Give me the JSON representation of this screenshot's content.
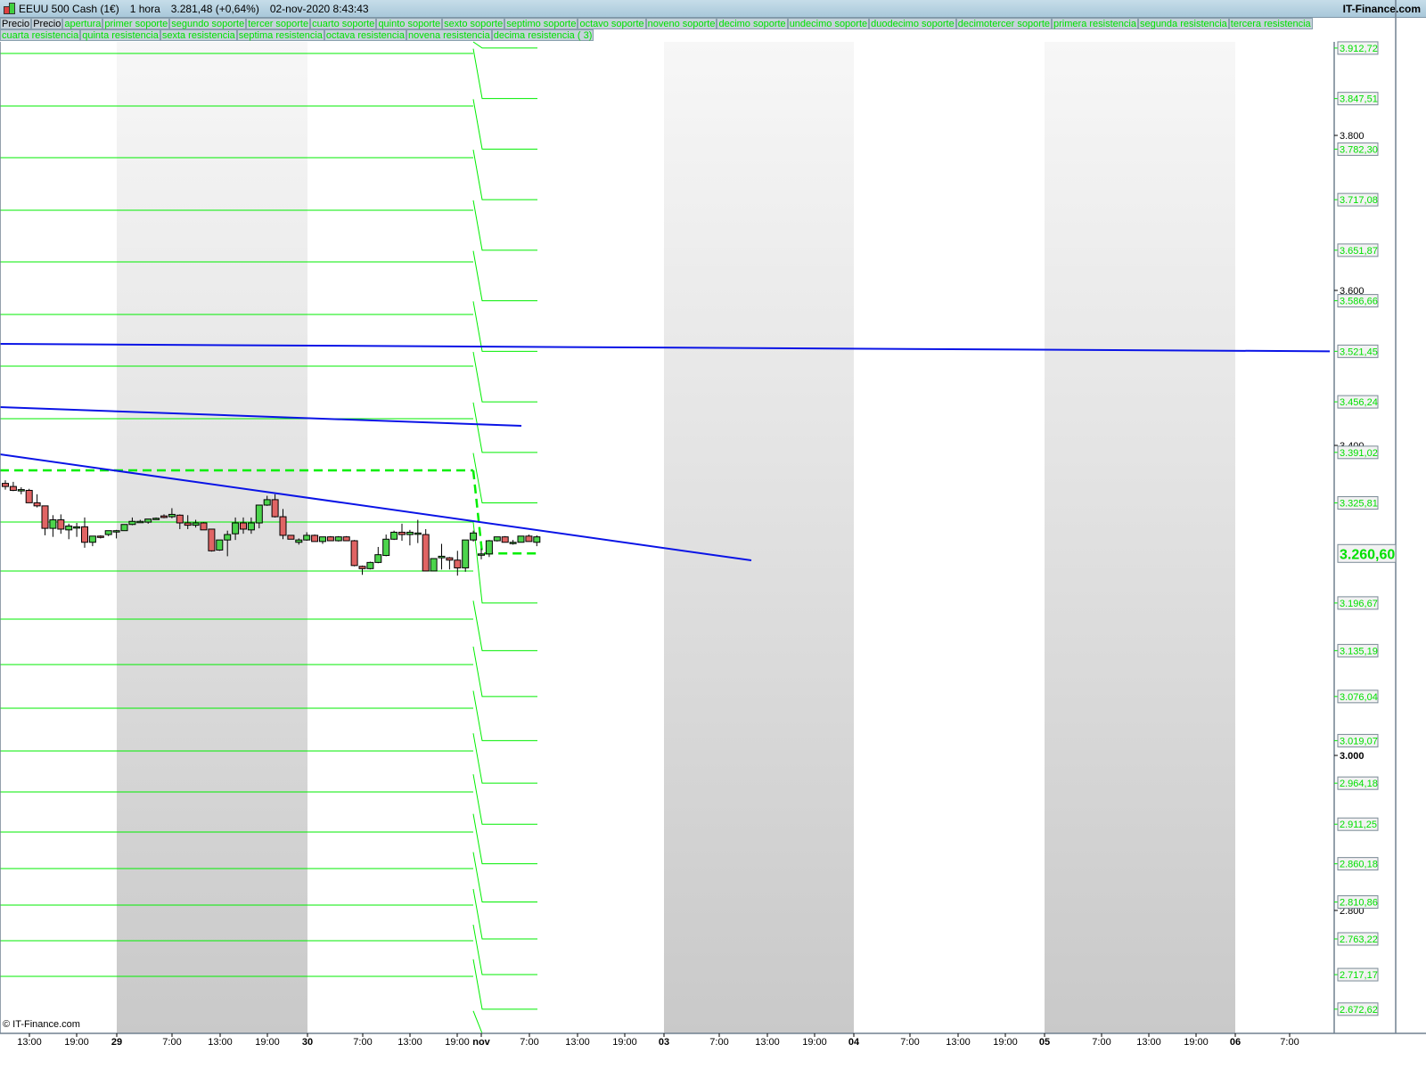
{
  "header": {
    "instrument": "EEUU 500 Cash (1€)",
    "timeframe": "1 hora",
    "price": "3.281,48 (+0,64%)",
    "datetime": "02-nov-2020 8:43:43",
    "brand": "IT-Finance.com"
  },
  "legend": {
    "row1": [
      "Precio",
      "Precio",
      "apertura",
      "primer soporte",
      "segundo soporte",
      "tercer soporte",
      "cuarto soporte",
      "quinto soporte",
      "sexto soporte",
      "septimo soporte",
      "octavo soporte",
      "noveno soporte",
      "decimo soporte",
      "undecimo soporte",
      "duodecimo soporte",
      "decimotercer soporte",
      "primera resistencia",
      "segunda resistencia",
      "tercera resistencia"
    ],
    "row2": [
      "cuarta resistencia",
      "quinta resistencia",
      "sexta resistencia",
      "septima resistencia",
      "octava resistencia",
      "novena resistencia",
      "decima resistencia ( 3)"
    ]
  },
  "copyright": "© IT-Finance.com",
  "colors": {
    "level": "#00ee00",
    "trend": "#0a14e6",
    "up": "#4cd44c",
    "down": "#e06464",
    "band": "#d4d4d4"
  },
  "chart_data": {
    "type": "candlestick",
    "price_axis_ticks": [
      {
        "value": 3800,
        "label": "3.800",
        "bold": false
      },
      {
        "value": 3600,
        "label": "3.600",
        "bold": false
      },
      {
        "value": 3400,
        "label": "3.400",
        "bold": false
      },
      {
        "value": 3000,
        "label": "3.000",
        "bold": true
      },
      {
        "value": 2800,
        "label": "2.800",
        "bold": false
      }
    ],
    "level_labels": [
      {
        "value": 3912.72,
        "label": "3.912,72"
      },
      {
        "value": 3847.51,
        "label": "3.847,51"
      },
      {
        "value": 3782.3,
        "label": "3.782,30"
      },
      {
        "value": 3717.08,
        "label": "3.717,08"
      },
      {
        "value": 3651.87,
        "label": "3.651,87"
      },
      {
        "value": 3586.66,
        "label": "3.586,66"
      },
      {
        "value": 3521.45,
        "label": "3.521,45"
      },
      {
        "value": 3456.24,
        "label": "3.456,24"
      },
      {
        "value": 3391.02,
        "label": "3.391,02"
      },
      {
        "value": 3325.81,
        "label": "3.325,81"
      },
      {
        "value": 3196.67,
        "label": "3.196,67"
      },
      {
        "value": 3135.19,
        "label": "3.135,19"
      },
      {
        "value": 3076.04,
        "label": "3.076,04"
      },
      {
        "value": 3019.07,
        "label": "3.019,07"
      },
      {
        "value": 2964.18,
        "label": "2.964,18"
      },
      {
        "value": 2911.25,
        "label": "2.911,25"
      },
      {
        "value": 2860.18,
        "label": "2.860,18"
      },
      {
        "value": 2810.86,
        "label": "2.810,86"
      },
      {
        "value": 2763.22,
        "label": "2.763,22"
      },
      {
        "value": 2717.17,
        "label": "2.717,17"
      },
      {
        "value": 2672.62,
        "label": "2.672,62"
      }
    ],
    "current_open": {
      "value": 3260.6,
      "label": "3.260,60"
    },
    "previous_levels": [
      3905.7,
      3837.9,
      3771.3,
      3703.4,
      3636.8,
      3569.0,
      3502.3,
      3434.5,
      3301.1,
      3237.9,
      3175.9,
      3117.2,
      3060.9,
      3005.7,
      2952.9,
      2901.1,
      2854.0,
      2806.9,
      2760.9,
      2714.9
    ],
    "previous_open": 3367.8,
    "time_labels": [
      {
        "label": "13:00",
        "bold": false
      },
      {
        "label": "19:00",
        "bold": false
      },
      {
        "label": "29",
        "bold": true
      },
      {
        "label": "7:00",
        "bold": false
      },
      {
        "label": "13:00",
        "bold": false
      },
      {
        "label": "19:00",
        "bold": false
      },
      {
        "label": "30",
        "bold": true
      },
      {
        "label": "7:00",
        "bold": false
      },
      {
        "label": "13:00",
        "bold": false
      },
      {
        "label": "19:00",
        "bold": false
      },
      {
        "label": "nov",
        "bold": true
      },
      {
        "label": "7:00",
        "bold": false
      },
      {
        "label": "13:00",
        "bold": false
      },
      {
        "label": "19:00",
        "bold": false
      },
      {
        "label": "03",
        "bold": true
      },
      {
        "label": "7:00",
        "bold": false
      },
      {
        "label": "13:00",
        "bold": false
      },
      {
        "label": "19:00",
        "bold": false
      },
      {
        "label": "04",
        "bold": true
      },
      {
        "label": "7:00",
        "bold": false
      },
      {
        "label": "13:00",
        "bold": false
      },
      {
        "label": "19:00",
        "bold": false
      },
      {
        "label": "05",
        "bold": true
      },
      {
        "label": "7:00",
        "bold": false
      },
      {
        "label": "13:00",
        "bold": false
      },
      {
        "label": "19:00",
        "bold": false
      },
      {
        "label": "06",
        "bold": true
      },
      {
        "label": "7:00",
        "bold": false
      }
    ],
    "trendlines": [
      {
        "start": 3531,
        "end": 3521.45
      },
      {
        "start": 3449.4,
        "end": 3425.3
      },
      {
        "start": 3388.5,
        "end": 3251.7
      }
    ],
    "candles_ohlc": [
      [
        3351,
        3355,
        3343,
        3347
      ],
      [
        3347,
        3353,
        3341,
        3342
      ],
      [
        3343,
        3346,
        3337,
        3343
      ],
      [
        3342,
        3344,
        3326,
        3326
      ],
      [
        3326,
        3337,
        3320,
        3322
      ],
      [
        3322,
        3322,
        3284,
        3293
      ],
      [
        3293,
        3310,
        3282,
        3304
      ],
      [
        3304,
        3311,
        3286,
        3292
      ],
      [
        3291,
        3299,
        3279,
        3296
      ],
      [
        3295,
        3300,
        3282,
        3295
      ],
      [
        3295,
        3307,
        3268,
        3275
      ],
      [
        3275,
        3283,
        3270,
        3283
      ],
      [
        3283,
        3284,
        3280,
        3282
      ],
      [
        3285,
        3290,
        3283,
        3290
      ],
      [
        3290,
        3291,
        3280,
        3290
      ],
      [
        3290,
        3298,
        3290,
        3298
      ],
      [
        3298,
        3307,
        3297,
        3302
      ],
      [
        3302,
        3304,
        3300,
        3302
      ],
      [
        3301,
        3305,
        3299,
        3305
      ],
      [
        3306,
        3307,
        3305,
        3306
      ],
      [
        3309,
        3311,
        3306,
        3307
      ],
      [
        3308,
        3319,
        3306,
        3311
      ],
      [
        3310,
        3311,
        3292,
        3300
      ],
      [
        3300,
        3310,
        3292,
        3297
      ],
      [
        3297,
        3304,
        3294,
        3300
      ],
      [
        3300,
        3301,
        3291,
        3291
      ],
      [
        3292,
        3292,
        3263,
        3264
      ],
      [
        3265,
        3278,
        3264,
        3278
      ],
      [
        3278,
        3290,
        3257,
        3285
      ],
      [
        3286,
        3307,
        3278,
        3300
      ],
      [
        3300,
        3307,
        3286,
        3292
      ],
      [
        3291,
        3307,
        3286,
        3300
      ],
      [
        3300,
        3323,
        3293,
        3323
      ],
      [
        3323,
        3335,
        3322,
        3330
      ],
      [
        3330,
        3337,
        3307,
        3308
      ],
      [
        3308,
        3318,
        3279,
        3284
      ],
      [
        3284,
        3284,
        3279,
        3279
      ],
      [
        3275,
        3280,
        3272,
        3278
      ],
      [
        3278,
        3288,
        3277,
        3284
      ],
      [
        3284,
        3285,
        3276,
        3276
      ],
      [
        3276,
        3282,
        3273,
        3282
      ],
      [
        3282,
        3283,
        3277,
        3277
      ],
      [
        3277,
        3283,
        3276,
        3282
      ],
      [
        3282,
        3283,
        3277,
        3277
      ],
      [
        3277,
        3278,
        3244,
        3245
      ],
      [
        3244,
        3245,
        3233,
        3241
      ],
      [
        3241,
        3250,
        3240,
        3249
      ],
      [
        3249,
        3269,
        3248,
        3259
      ],
      [
        3258,
        3285,
        3257,
        3279
      ],
      [
        3279,
        3290,
        3278,
        3288
      ],
      [
        3288,
        3299,
        3277,
        3285
      ],
      [
        3285,
        3291,
        3271,
        3288
      ],
      [
        3287,
        3304,
        3274,
        3287
      ],
      [
        3285,
        3292,
        3238,
        3238
      ],
      [
        3238,
        3254,
        3238,
        3254
      ],
      [
        3255,
        3273,
        3240,
        3257
      ],
      [
        3255,
        3256,
        3240,
        3252
      ],
      [
        3252,
        3264,
        3232,
        3242
      ],
      [
        3242,
        3278,
        3237,
        3278
      ],
      [
        3278,
        3290,
        3276,
        3287
      ],
      [
        3260,
        3267,
        3253,
        3260
      ],
      [
        3260,
        3278,
        3256,
        3277
      ],
      [
        3277,
        3282,
        3276,
        3282
      ],
      [
        3282,
        3283,
        3275,
        3275
      ],
      [
        3275,
        3278,
        3272,
        3275
      ],
      [
        3275,
        3283,
        3275,
        3283
      ],
      [
        3283,
        3285,
        3276,
        3276
      ],
      [
        3275,
        3284,
        3270,
        3282
      ]
    ]
  }
}
